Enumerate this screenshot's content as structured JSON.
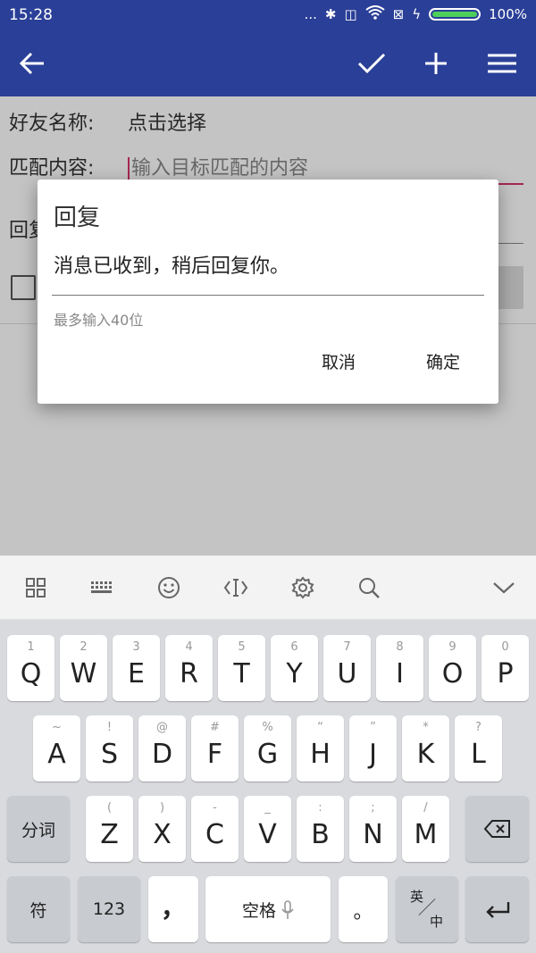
{
  "status": {
    "time": "15:28",
    "dots": "...",
    "battery_pct": "100%"
  },
  "app_bar": {
    "back_icon": "arrow-left-icon",
    "confirm_icon": "check-icon",
    "add_icon": "plus-icon",
    "menu_icon": "menu-icon"
  },
  "form": {
    "friend_label": "好友名称:",
    "friend_value": "点击选择",
    "match_label": "匹配内容:",
    "match_placeholder": "输入目标匹配的内容",
    "reply_label_visible": "回复"
  },
  "dialog": {
    "title": "回复",
    "input_value": "消息已收到，稍后回复你。",
    "helper": "最多输入40位",
    "cancel": "取消",
    "ok": "确定"
  },
  "keyboard": {
    "row1": [
      {
        "h": "1",
        "c": "Q"
      },
      {
        "h": "2",
        "c": "W"
      },
      {
        "h": "3",
        "c": "E"
      },
      {
        "h": "4",
        "c": "R"
      },
      {
        "h": "5",
        "c": "T"
      },
      {
        "h": "6",
        "c": "Y"
      },
      {
        "h": "7",
        "c": "U"
      },
      {
        "h": "8",
        "c": "I"
      },
      {
        "h": "9",
        "c": "O"
      },
      {
        "h": "0",
        "c": "P"
      }
    ],
    "row2": [
      {
        "h": "~",
        "c": "A"
      },
      {
        "h": "!",
        "c": "S"
      },
      {
        "h": "@",
        "c": "D"
      },
      {
        "h": "#",
        "c": "F"
      },
      {
        "h": "%",
        "c": "G"
      },
      {
        "h": "“",
        "c": "H"
      },
      {
        "h": "”",
        "c": "J"
      },
      {
        "h": "*",
        "c": "K"
      },
      {
        "h": "?",
        "c": "L"
      }
    ],
    "row3": [
      {
        "h": "(",
        "c": "Z"
      },
      {
        "h": ")",
        "c": "X"
      },
      {
        "h": "-",
        "c": "C"
      },
      {
        "h": "_",
        "c": "V"
      },
      {
        "h": ":",
        "c": "B"
      },
      {
        "h": ";",
        "c": "N"
      },
      {
        "h": "/",
        "c": "M"
      }
    ],
    "fenci": "分词",
    "fu": "符",
    "num": "123",
    "comma": "，",
    "space": "空格",
    "period": "。",
    "lang_top": "英",
    "lang_bottom": "中"
  }
}
